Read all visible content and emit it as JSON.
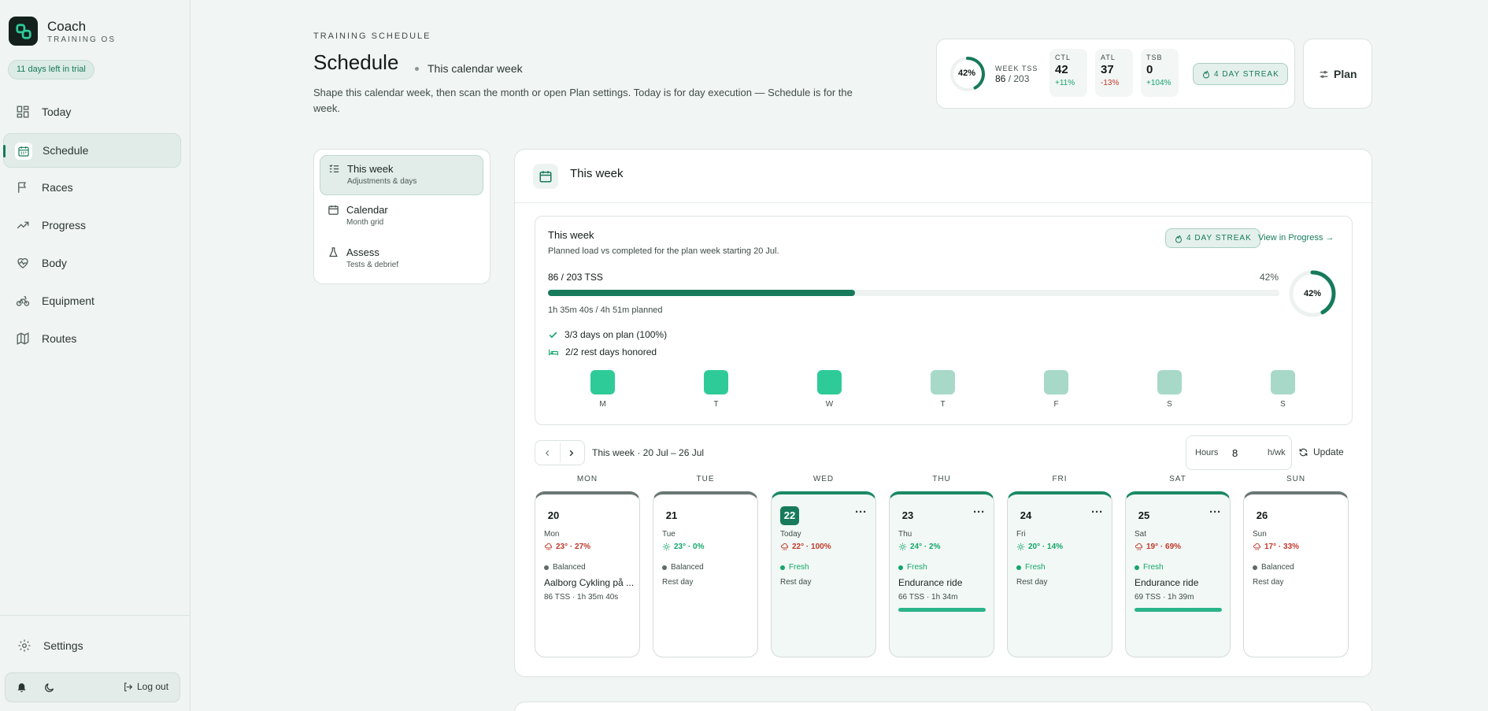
{
  "brand": {
    "name": "Coach",
    "sub": "TRAINING OS"
  },
  "trial": "11 days left in trial",
  "nav": [
    {
      "label": "Today",
      "icon": "grid-icon"
    },
    {
      "label": "Schedule",
      "icon": "calendar-icon",
      "active": true
    },
    {
      "label": "Races",
      "icon": "flag-icon"
    },
    {
      "label": "Progress",
      "icon": "trending-up-icon"
    },
    {
      "label": "Body",
      "icon": "heart-pulse-icon"
    },
    {
      "label": "Equipment",
      "icon": "bike-icon"
    },
    {
      "label": "Routes",
      "icon": "map-icon"
    }
  ],
  "settings": "Settings",
  "logout": "Log out",
  "header": {
    "eyebrow": "TRAINING SCHEDULE",
    "title": "Schedule",
    "subtitle": "This calendar week",
    "description": "Shape this calendar week, then scan the month or open Plan settings. Today is for day execution — Schedule is for the week."
  },
  "stats": {
    "ring_pct": "42%",
    "ring_value": 0.42,
    "week_tss_label": "WEEK TSS",
    "week_tss_done": "86",
    "week_tss_total": " / 203",
    "ctl": {
      "k": "CTL",
      "v": "42",
      "d": "+11%"
    },
    "atl": {
      "k": "ATL",
      "v": "37",
      "d": "-13%"
    },
    "tsb": {
      "k": "TSB",
      "v": "0",
      "d": "+104%"
    },
    "streak": "4  DAY STREAK",
    "plan": "Plan"
  },
  "subnav": [
    {
      "title": "This week",
      "sub": "Adjustments & days",
      "active": true
    },
    {
      "title": "Calendar",
      "sub": "Month grid"
    },
    {
      "title": "Assess",
      "sub": "Tests & debrief"
    }
  ],
  "panel": {
    "title": "This week",
    "card": {
      "title": "This week",
      "desc": "Planned load vs completed for the plan week starting 20 Jul.",
      "streak": "4  DAY STREAK",
      "view_link": "View in Progress →",
      "tss": "86 / 203 TSS",
      "pct": "42%",
      "progress": 0.42,
      "time": "1h 35m 40s / 4h 51m planned",
      "on_plan": "3/3 days on plan (100%)",
      "rest": "2/2 rest days honored",
      "days": [
        {
          "l": "M",
          "done": true
        },
        {
          "l": "T",
          "done": true
        },
        {
          "l": "W",
          "done": true
        },
        {
          "l": "T",
          "done": false
        },
        {
          "l": "F",
          "done": false
        },
        {
          "l": "S",
          "done": false
        },
        {
          "l": "S",
          "done": false
        }
      ]
    },
    "week_label": "This week · 20 Jul – 26 Jul",
    "hours_label": "Hours",
    "hours_value": "8",
    "hours_unit": "h/wk",
    "update": "Update",
    "colors": {
      "done": "#2ecb98",
      "pending": "#a8d9c8",
      "accent": "#167a5b",
      "warm": "#c0392b",
      "fresh": "#13a66a"
    },
    "days": [
      {
        "head": "MON",
        "num": "20",
        "name": "Mon",
        "weather": "23° · 27%",
        "wicon": "rain-icon",
        "wcolor": "#c0392b",
        "status": "Balanced",
        "title": "Aalborg Cykling på ...",
        "meta": "86 TSS · 1h 35m 40s",
        "green": false
      },
      {
        "head": "TUE",
        "num": "21",
        "name": "Tue",
        "weather": "23° · 0%",
        "wicon": "sun-icon",
        "wcolor": "#13a66a",
        "status": "Balanced",
        "rest": "Rest day",
        "green": false
      },
      {
        "head": "WED",
        "num": "22",
        "name": "Today",
        "weather": "22° · 100%",
        "wicon": "rain-icon",
        "wcolor": "#c0392b",
        "status": "Fresh",
        "rest": "Rest day",
        "green": true,
        "today": true
      },
      {
        "head": "THU",
        "num": "23",
        "name": "Thu",
        "weather": "24° · 2%",
        "wicon": "sun-icon",
        "wcolor": "#13a66a",
        "status": "Fresh",
        "title": "Endurance ride",
        "meta": "66 TSS · 1h 34m",
        "green": true,
        "bar": true
      },
      {
        "head": "FRI",
        "num": "24",
        "name": "Fri",
        "weather": "20° · 14%",
        "wicon": "sun-icon",
        "wcolor": "#13a66a",
        "status": "Fresh",
        "rest": "Rest day",
        "green": true
      },
      {
        "head": "SAT",
        "num": "25",
        "name": "Sat",
        "weather": "19° · 69%",
        "wicon": "rain-icon",
        "wcolor": "#c0392b",
        "status": "Fresh",
        "title": "Endurance ride",
        "meta": "69 TSS · 1h 39m",
        "green": true,
        "bar": true
      },
      {
        "head": "SUN",
        "num": "26",
        "name": "Sun",
        "weather": "17° · 33%",
        "wicon": "rain-icon",
        "wcolor": "#c0392b",
        "status": "Balanced",
        "rest": "Rest day",
        "green": false
      }
    ]
  }
}
